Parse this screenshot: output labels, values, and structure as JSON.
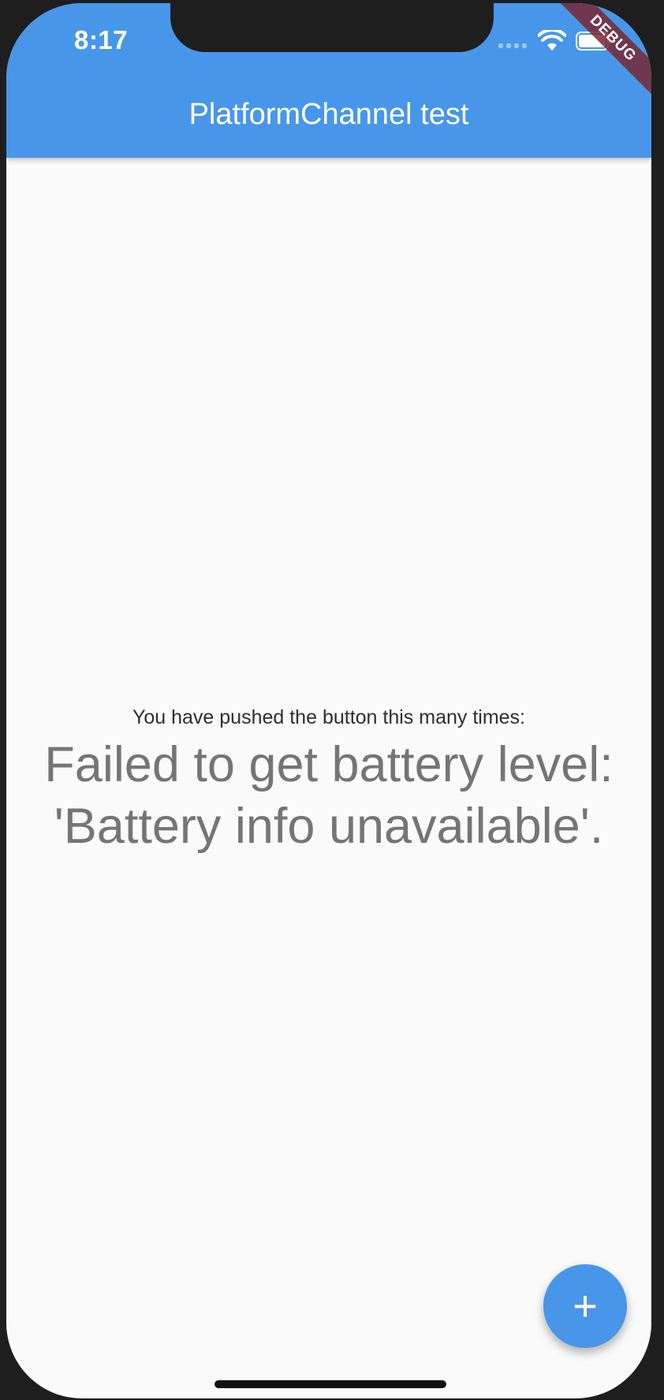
{
  "status_bar": {
    "time": "8:17"
  },
  "debug_banner": "DEBUG",
  "app_bar": {
    "title": "PlatformChannel test"
  },
  "main": {
    "counter_label": "You have pushed the button this many times:",
    "counter_value": "Failed to get battery level: 'Battery info unavailable'."
  },
  "fab": {
    "icon": "add-icon",
    "symbol": "+"
  },
  "colors": {
    "primary": "#4896ea",
    "background": "#fafafa",
    "debug_banner": "#782832"
  }
}
